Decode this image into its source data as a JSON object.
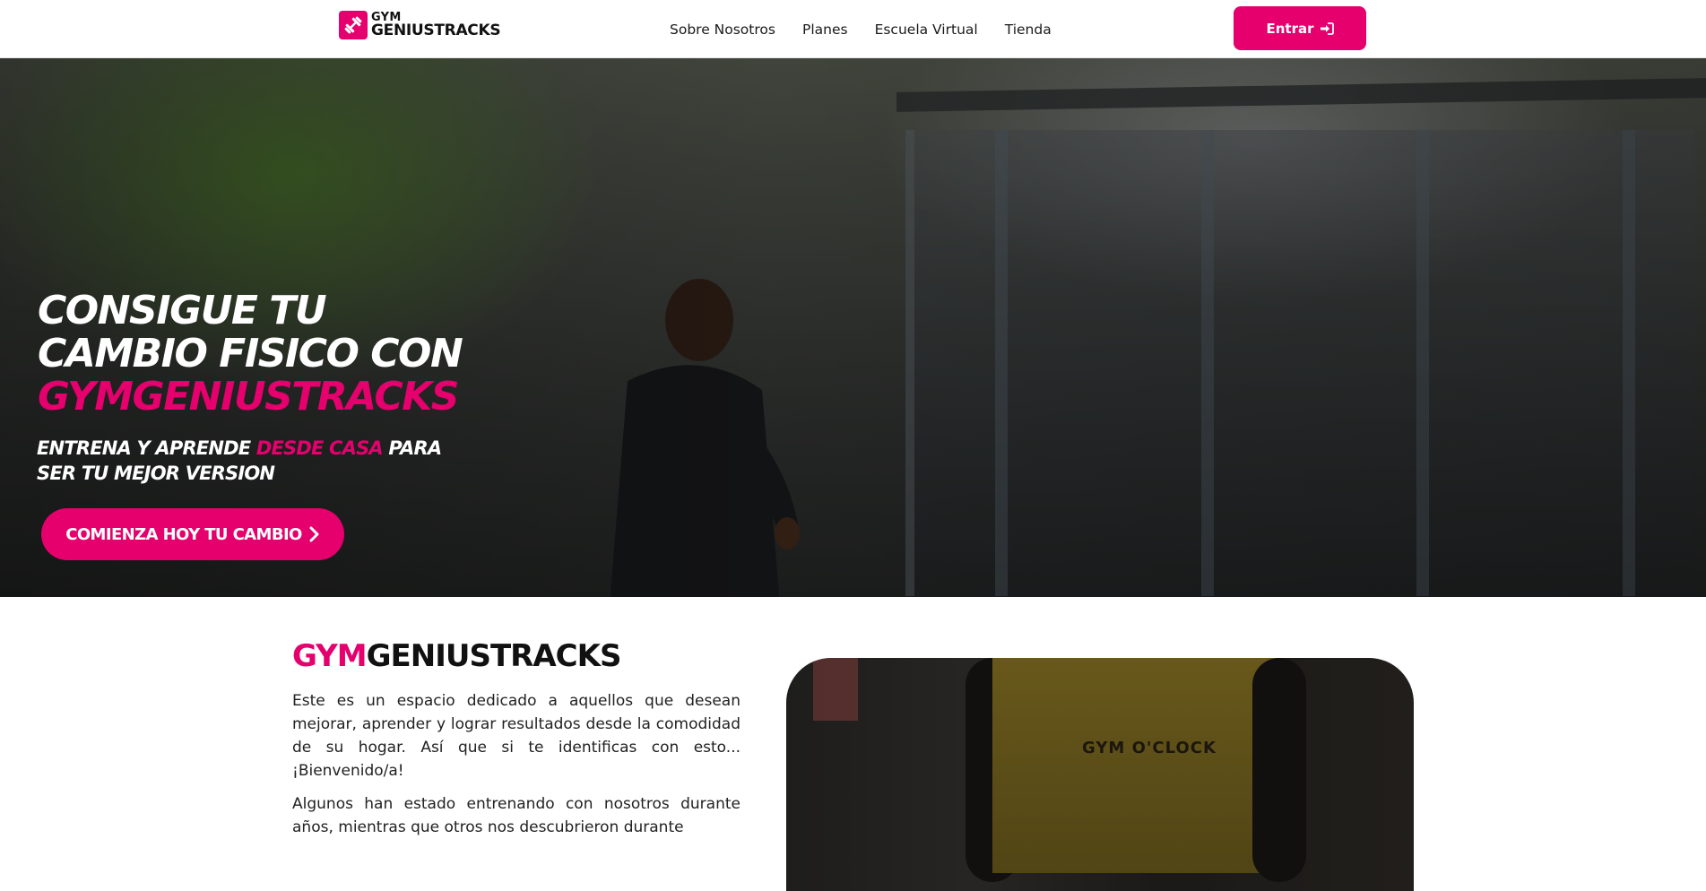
{
  "navbar": {
    "logo_top": "GYM",
    "logo_bottom": "GENIUSTRACKS",
    "links": [
      "Sobre Nosotros",
      "Planes",
      "Escuela Virtual",
      "Tienda"
    ],
    "login_label": "Entrar",
    "login_icon": "sign-in-icon"
  },
  "hero": {
    "title_line1": "CONSIGUE TU",
    "title_line2": "CAMBIO FISICO CON",
    "title_accent": "GYMGENIUSTRACKS",
    "sub_part1": "ENTRENA Y APRENDE ",
    "sub_accent": "DESDE CASA",
    "sub_part2": " PARA SER TU MEJOR VERSION",
    "cta_label": "COMIENZA HOY TU CAMBIO",
    "cta_icon": "chevron-right-icon"
  },
  "about": {
    "title_accent": "GYM",
    "title_rest": "GENIUSTRACKS",
    "paragraph1": "Este es un espacio dedicado a aquellos que desean mejorar, aprender y lograr resultados desde la comodidad de su hogar. Así que si te identificas con esto... ¡Bienvenido/a!",
    "paragraph2": "Algunos han estado entrenando con nosotros durante años, mientras que otros nos descubrieron durante",
    "image_shirt_text": "GYM O'CLOCK"
  },
  "colors": {
    "accent": "#e5006d",
    "text_dark": "#111111",
    "white": "#ffffff"
  }
}
